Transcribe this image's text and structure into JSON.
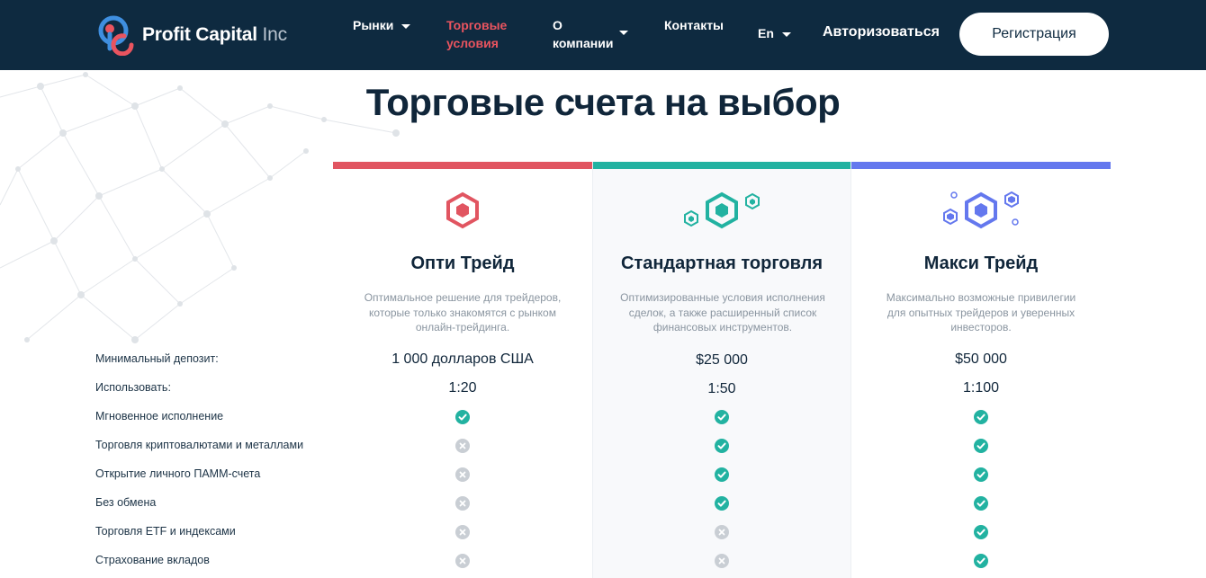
{
  "brand": {
    "name": "Profit Capital",
    "suffix": "Inc"
  },
  "nav": {
    "markets": "Рынки",
    "trading_conditions_line1": "Торговые",
    "trading_conditions_line2": "условия",
    "about_line1": "О",
    "about_line2": "компании",
    "contacts": "Контакты",
    "language": "En",
    "login": "Авторизоваться",
    "register": "Регистрация"
  },
  "page": {
    "title": "Торговые счета на выбор"
  },
  "colors": {
    "header_bg": "#0e2a40",
    "accent_red": "#e15561",
    "accent_teal": "#22b2a1",
    "accent_blue": "#6478ee"
  },
  "rows": [
    "Минимальный депозит:",
    "Использовать:",
    "Мгновенное исполнение",
    "Торговля криптовалютами и металлами",
    "Открытие личного ПАММ-счета",
    "Без обмена",
    "Торговля ETF и индексами",
    "Страхование вкладов"
  ],
  "plans": [
    {
      "name": "Опти Трейд",
      "description": "Оптимальное решение для трейдеров, которые только знакомятся с рынком онлайн-трейдинга.",
      "min_deposit": "1 000 долларов США",
      "leverage": "1:20",
      "features": [
        true,
        false,
        false,
        false,
        false,
        false
      ]
    },
    {
      "name": "Стандартная торговля",
      "description": "Оптимизированные условия исполнения сделок, а также расширенный список финансовых инструментов.",
      "min_deposit": "$25 000",
      "leverage": "1:50",
      "features": [
        true,
        true,
        true,
        true,
        false,
        false
      ]
    },
    {
      "name": "Макси Трейд",
      "description": "Максимально возможные привилегии для опытных трейдеров и уверенных инвесторов.",
      "min_deposit": "$50 000",
      "leverage": "1:100",
      "features": [
        true,
        true,
        true,
        true,
        true,
        true
      ]
    }
  ]
}
